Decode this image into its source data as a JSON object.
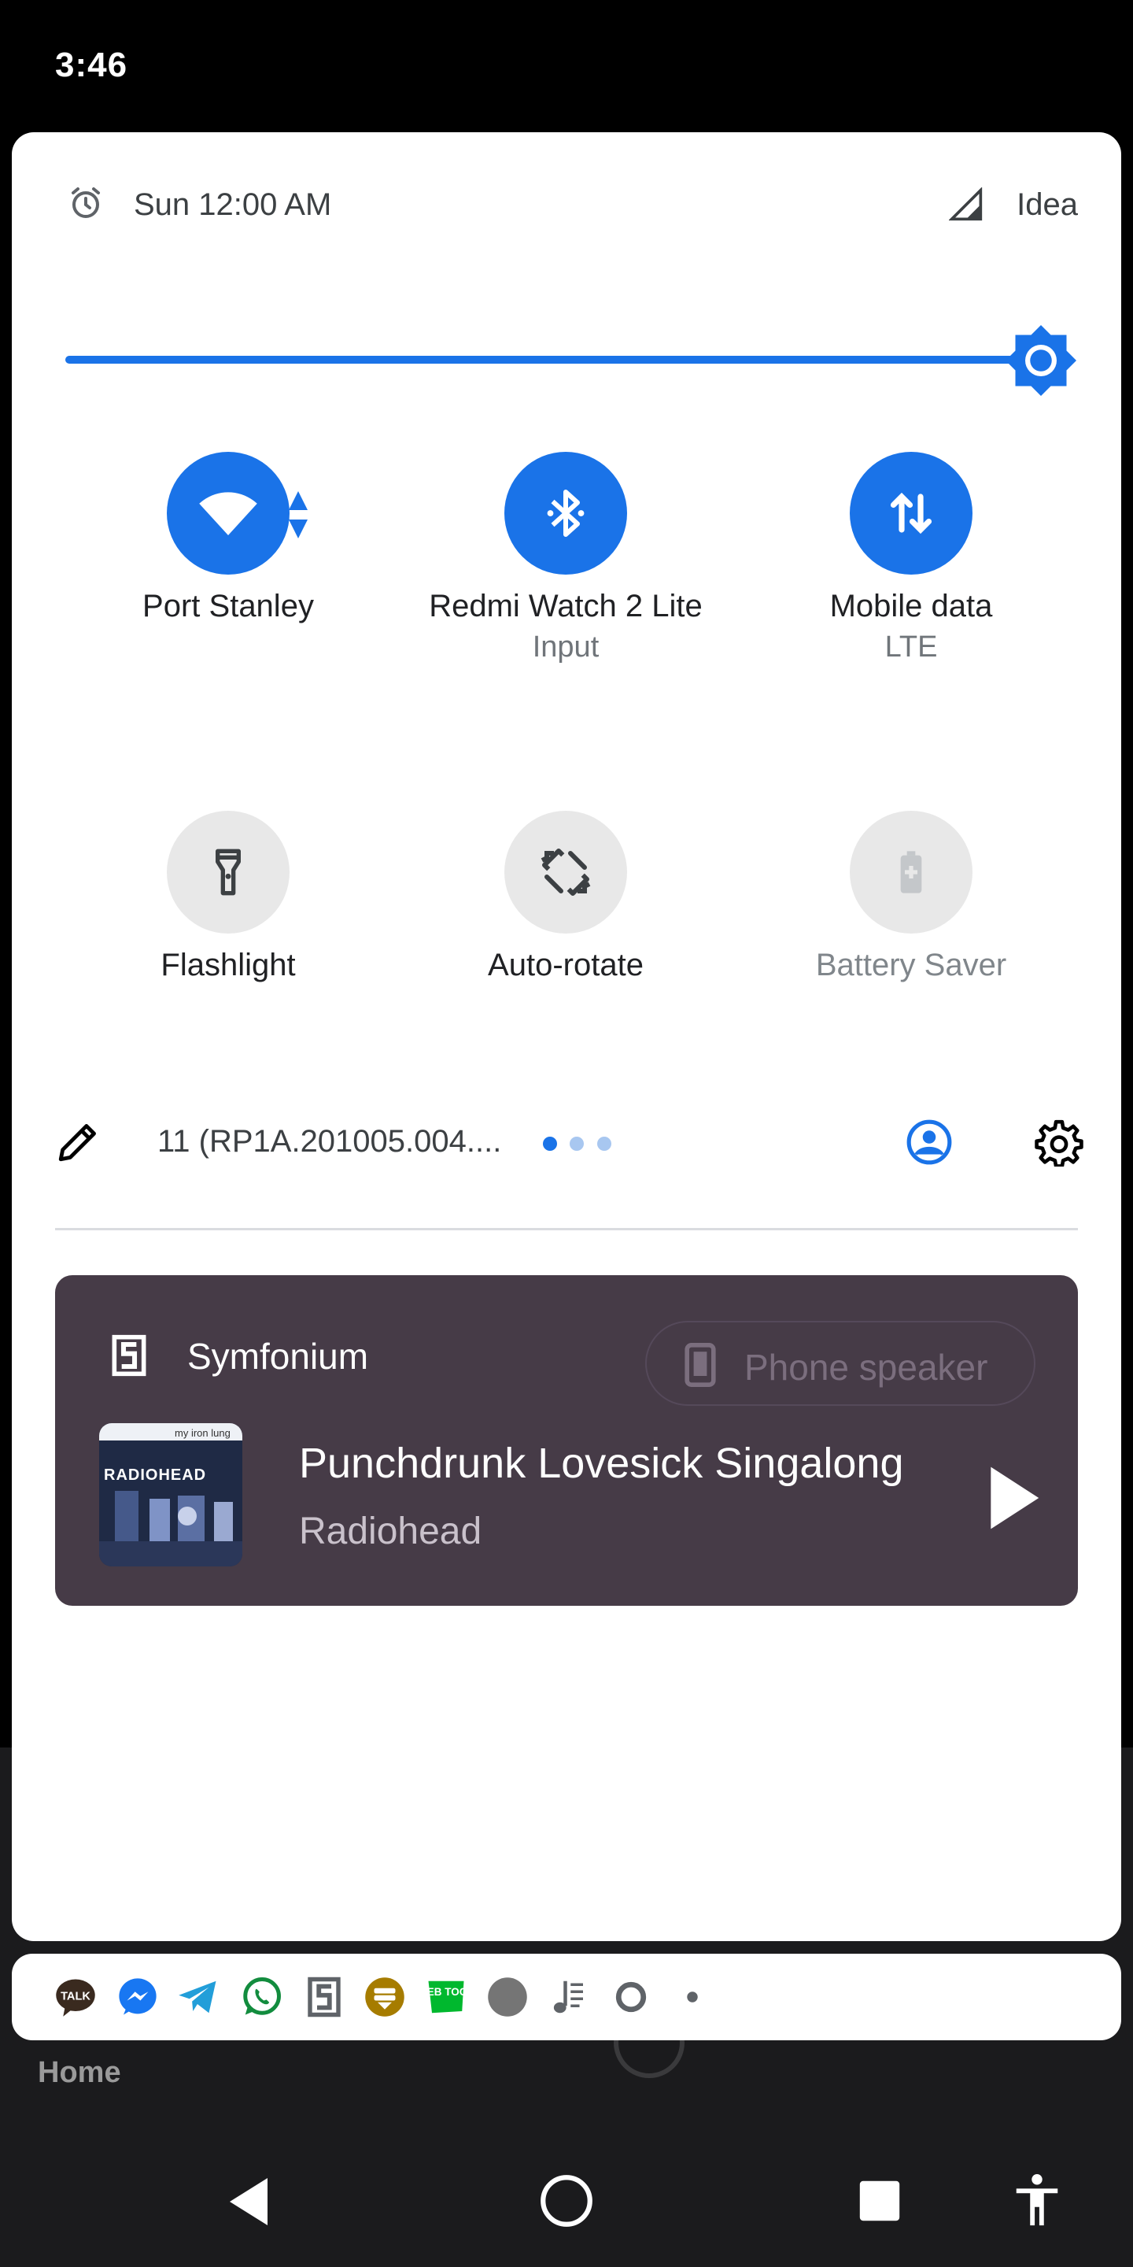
{
  "status_bar": {
    "time": "3:46"
  },
  "quick_settings": {
    "alarm_text": "Sun 12:00 AM",
    "carrier": "Idea",
    "brightness_level": 0.96,
    "tiles": [
      {
        "label": "Port Stanley",
        "sublabel": "",
        "icon": "wifi-icon",
        "state": "on"
      },
      {
        "label": "Redmi Watch 2 Lite",
        "sublabel": "Input",
        "icon": "bluetooth-icon",
        "state": "on"
      },
      {
        "label": "Mobile data",
        "sublabel": "LTE",
        "icon": "mobile-data-icon",
        "state": "on"
      },
      {
        "label": "Flashlight",
        "sublabel": "",
        "icon": "flashlight-icon",
        "state": "off"
      },
      {
        "label": "Auto-rotate",
        "sublabel": "",
        "icon": "auto-rotate-icon",
        "state": "off"
      },
      {
        "label": "Battery Saver",
        "sublabel": "",
        "icon": "battery-saver-icon",
        "state": "unavailable"
      }
    ],
    "build_number": "11 (RP1A.201005.004....",
    "page_count": 3,
    "current_page": 1
  },
  "media": {
    "app_name": "Symfonium",
    "output_device": "Phone speaker",
    "title": "Punchdrunk Lovesick Singalong",
    "artist": "Radiohead",
    "album_art_text": "RADIOHEAD",
    "album_art_subtext": "my iron lung"
  },
  "notification_icons": [
    {
      "name": "kakaotalk-icon",
      "text": "TALK"
    },
    {
      "name": "messenger-icon"
    },
    {
      "name": "telegram-icon"
    },
    {
      "name": "whatsapp-icon"
    },
    {
      "name": "symfonium-icon"
    },
    {
      "name": "bitwarden-icon"
    },
    {
      "name": "webtoon-icon",
      "text": "WEB TOON"
    },
    {
      "name": "gray-circle-icon"
    },
    {
      "name": "music-note-icon"
    },
    {
      "name": "ring-icon"
    },
    {
      "name": "more-dot-icon"
    }
  ],
  "background_app": {
    "tab_label": "Home"
  },
  "colors": {
    "accent": "#1a73e8",
    "panel": "#ffffff",
    "media_card": "#463b47",
    "tile_off": "#e8e8e8"
  }
}
